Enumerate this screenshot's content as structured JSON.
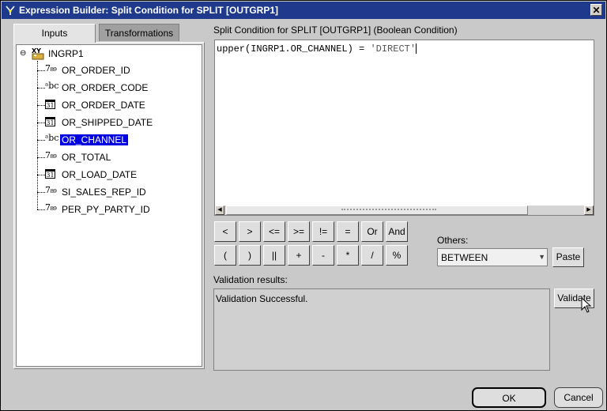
{
  "window": {
    "title": "Expression Builder: Split Condition for SPLIT  [OUTGRP1]",
    "close_glyph": "✕"
  },
  "tabs": [
    {
      "label": "Inputs",
      "active": true
    },
    {
      "label": "Transformations",
      "active": false
    }
  ],
  "tree": {
    "toggle_glyph": "⊖",
    "root": {
      "label": "INGRP1",
      "icon": "group-icon"
    },
    "items": [
      {
        "label": "OR_ORDER_ID",
        "type": "number",
        "icon_text": "7₈₉"
      },
      {
        "label": "OR_ORDER_CODE",
        "type": "string",
        "icon_text": "ᵃbc"
      },
      {
        "label": "OR_ORDER_DATE",
        "type": "date",
        "icon_text": "31"
      },
      {
        "label": "OR_SHIPPED_DATE",
        "type": "date",
        "icon_text": "31"
      },
      {
        "label": "OR_CHANNEL",
        "type": "string",
        "icon_text": "ᵃbc",
        "selected": true
      },
      {
        "label": "OR_TOTAL",
        "type": "number",
        "icon_text": "7₈₉"
      },
      {
        "label": "OR_LOAD_DATE",
        "type": "date",
        "icon_text": "31"
      },
      {
        "label": "SI_SALES_REP_ID",
        "type": "number",
        "icon_text": "7₈₉"
      },
      {
        "label": "PER_PY_PARTY_ID",
        "type": "number",
        "icon_text": "7₈₉"
      }
    ]
  },
  "expression": {
    "label": "Split Condition for SPLIT  [OUTGRP1]   (Boolean Condition)",
    "code": "upper(INGRP1.OR_CHANNEL) = ",
    "string_literal": "'DIRECT'"
  },
  "operators": {
    "row1": [
      "<",
      ">",
      "<=",
      ">=",
      "!=",
      "=",
      "Or",
      "And"
    ],
    "row2": [
      "(",
      ")",
      "||",
      "+",
      "-",
      "*",
      "/",
      "%"
    ]
  },
  "others": {
    "label": "Others:",
    "selected": "BETWEEN",
    "arrow_glyph": "▼",
    "paste_label": "Paste"
  },
  "validation": {
    "label": "Validation results:",
    "text": "Validation Successful.",
    "validate_label": "Validate"
  },
  "footer": {
    "ok_label": "OK",
    "cancel_label": "Cancel"
  },
  "colors": {
    "titlebar": "#1f3a8c",
    "selection": "#0000e0",
    "background": "#c9c9c9"
  }
}
